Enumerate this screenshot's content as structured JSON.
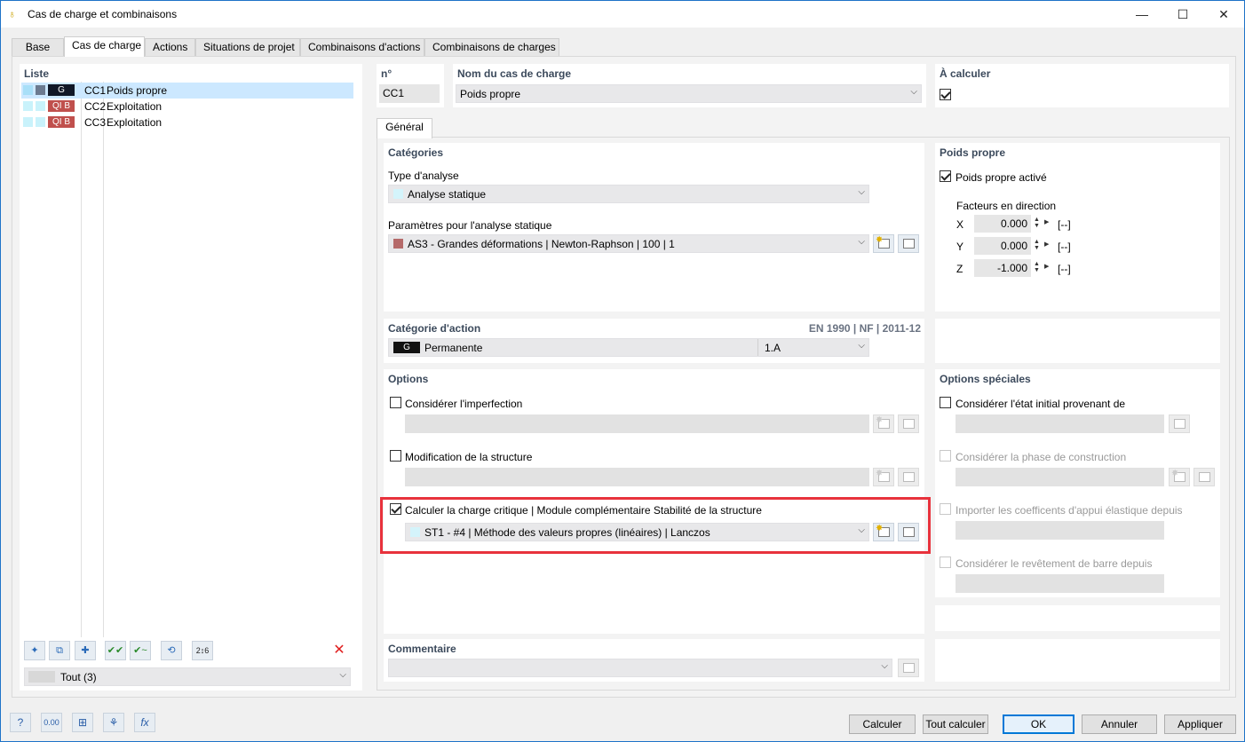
{
  "window": {
    "title": "Cas de charge et combinaisons"
  },
  "tabs": [
    "Base",
    "Cas de charge",
    "Actions",
    "Situations de projet",
    "Combinaisons d'actions",
    "Combinaisons de charges"
  ],
  "list": {
    "header": "Liste",
    "items": [
      {
        "tag": "G",
        "tag_color": "#111827",
        "id": "CC1",
        "name": "Poids propre"
      },
      {
        "tag": "QI B",
        "tag_color": "#c0504d",
        "id": "CC2",
        "name": "Exploitation"
      },
      {
        "tag": "QI B",
        "tag_color": "#c0504d",
        "id": "CC3",
        "name": "Exploitation"
      }
    ],
    "filter_value": "Tout (3)"
  },
  "header": {
    "no_label": "n°",
    "no_value": "CC1",
    "name_label": "Nom du cas de charge",
    "name_value": "Poids propre",
    "calc_label": "À calculer"
  },
  "subtab": "Général",
  "categories": {
    "title": "Catégories",
    "analysis_label": "Type d'analyse",
    "analysis_value": "Analyse statique",
    "params_label": "Paramètres pour l'analyse statique",
    "params_value": "AS3 - Grandes déformations | Newton-Raphson | 100 | 1"
  },
  "self_weight": {
    "title": "Poids propre",
    "active_label": "Poids propre activé",
    "factors_label": "Facteurs en direction",
    "factors": [
      {
        "axis": "X",
        "value": "0.000",
        "unit": "[--]"
      },
      {
        "axis": "Y",
        "value": "0.000",
        "unit": "[--]"
      },
      {
        "axis": "Z",
        "value": "-1.000",
        "unit": "[--]"
      }
    ]
  },
  "action_category": {
    "title": "Catégorie d'action",
    "norm": "EN 1990 | NF | 2011-12",
    "tag": "G",
    "value": "Permanente",
    "code": "1.A"
  },
  "options": {
    "title": "Options",
    "imperfection_label": "Considérer l'imperfection",
    "modification_label": "Modification de la structure",
    "critical_label": "Calculer la charge critique | Module complémentaire Stabilité de la structure",
    "critical_value": "ST1 - #4 | Méthode des valeurs propres (linéaires) | Lanczos"
  },
  "special_options": {
    "title": "Options spéciales",
    "initial_state_label": "Considérer l'état initial provenant de",
    "construction_label": "Considérer la phase de construction",
    "import_label": "Importer les coefficents d'appui élastique depuis",
    "coating_label": "Considérer le revêtement de barre depuis"
  },
  "comment": {
    "title": "Commentaire"
  },
  "buttons": {
    "calculate": "Calculer",
    "calculate_all": "Tout calculer",
    "ok": "OK",
    "cancel": "Annuler",
    "apply": "Appliquer"
  },
  "colors": {
    "highlight": "#e8323c",
    "selected_row": "#cce8ff",
    "accent": "#0078d7"
  },
  "icons": {
    "bottom_left": [
      "help-icon",
      "units-icon",
      "model-info-icon",
      "filter-icon",
      "formula-icon"
    ]
  }
}
